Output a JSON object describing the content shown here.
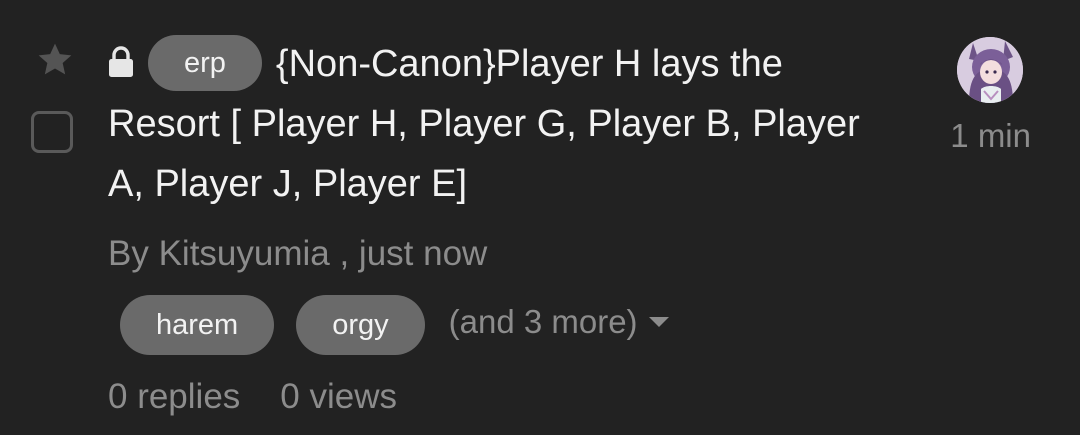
{
  "topic": {
    "prefix": "erp",
    "title": "{Non-Canon}Player H lays the Resort [ Player H, Player G, Player B, Player A, Player J, Player E]",
    "byline": "By Kitsuyumia , just now",
    "tags": [
      "harem",
      "orgy"
    ],
    "more_tags": "(and 3 more)",
    "replies": "0 replies",
    "views": "0 views",
    "time": "1 min",
    "locked": true,
    "starred": false,
    "selected": false
  },
  "icons": {
    "star": "star-icon",
    "lock": "lock-icon",
    "caret": "caret-down-icon"
  },
  "colors": {
    "background": "#222222",
    "text": "#f2f2f2",
    "muted": "#8c8c8c",
    "badge": "#6a6a6a"
  }
}
